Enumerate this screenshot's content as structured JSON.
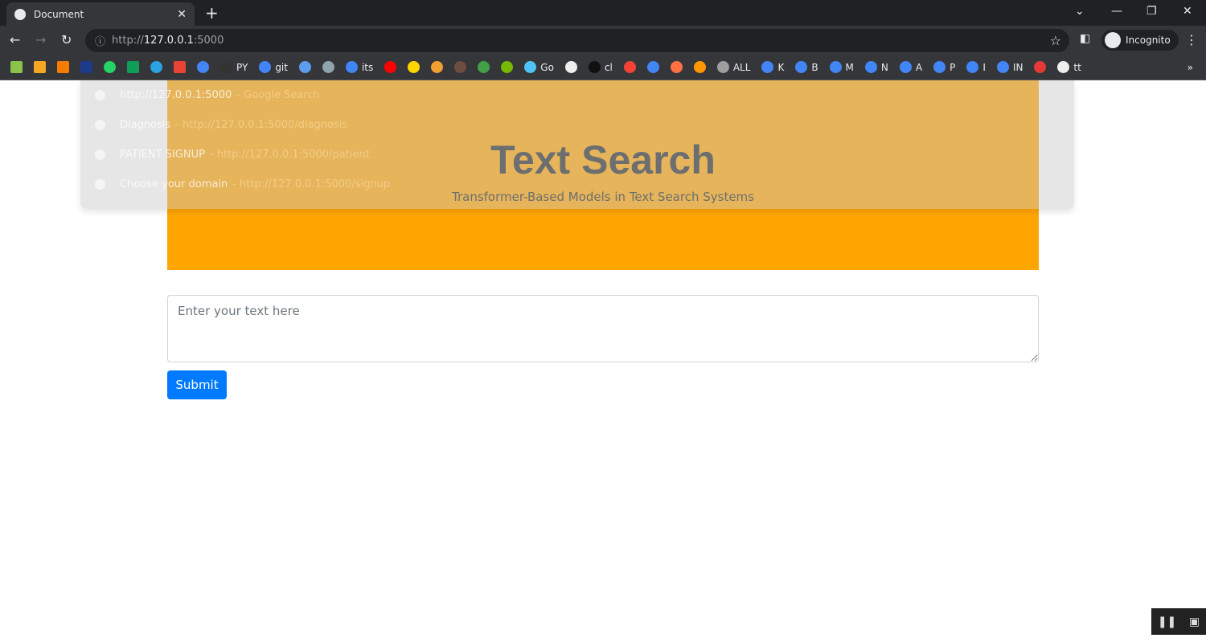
{
  "browser": {
    "tab_title": "Document",
    "url_scheme": "http://",
    "url_host": "127.0.0.1",
    "url_port": ":5000",
    "profile_label": "Incognito",
    "bookmarks": [
      {
        "label": "",
        "color": "#8bc34a"
      },
      {
        "label": "",
        "color": "#f5a623"
      },
      {
        "label": "",
        "color": "#f57c00"
      },
      {
        "label": "",
        "color": "#1e3a8a"
      },
      {
        "label": "",
        "color": "#25d366"
      },
      {
        "label": "",
        "color": "#0f9d58"
      },
      {
        "label": "",
        "color": "#2aa3e0"
      },
      {
        "label": "",
        "color": "#ea4335"
      },
      {
        "label": "",
        "color": "#4285f4"
      },
      {
        "label": "PY",
        "color": "#333333"
      },
      {
        "label": "git",
        "color": "#4285f4"
      },
      {
        "label": "",
        "color": "#5c9ded"
      },
      {
        "label": "",
        "color": "#90a4ae"
      },
      {
        "label": "its",
        "color": "#4285f4"
      },
      {
        "label": "",
        "color": "#ff0000"
      },
      {
        "label": "",
        "color": "#ffd600"
      },
      {
        "label": "",
        "color": "#f0a030"
      },
      {
        "label": "",
        "color": "#6d4c41"
      },
      {
        "label": "",
        "color": "#43a047"
      },
      {
        "label": "",
        "color": "#76b900"
      },
      {
        "label": "Go",
        "color": "#4fc3f7"
      },
      {
        "label": "",
        "color": "#eeeeee"
      },
      {
        "label": "cl",
        "color": "#111111"
      },
      {
        "label": "",
        "color": "#f44336"
      },
      {
        "label": "",
        "color": "#4285f4"
      },
      {
        "label": "",
        "color": "#ff7043"
      },
      {
        "label": "",
        "color": "#ff9800"
      },
      {
        "label": "ALL",
        "color": "#9e9e9e"
      },
      {
        "label": "K",
        "color": "#4285f4"
      },
      {
        "label": "B",
        "color": "#4285f4"
      },
      {
        "label": "M",
        "color": "#4285f4"
      },
      {
        "label": "N",
        "color": "#4285f4"
      },
      {
        "label": "A",
        "color": "#4285f4"
      },
      {
        "label": "P",
        "color": "#4285f4"
      },
      {
        "label": "I",
        "color": "#4285f4"
      },
      {
        "label": "IN",
        "color": "#4285f4"
      },
      {
        "label": "",
        "color": "#e53935"
      },
      {
        "label": "tt",
        "color": "#eeeeee"
      }
    ],
    "more_bookmarks": "»"
  },
  "omnibox_suggestions": [
    {
      "title": "http://127.0.0.1:5000",
      "url": "- Google Search",
      "icon": "search-icon"
    },
    {
      "title": "Diagnosis",
      "url": "- http://127.0.0.1:5000/diagnosis",
      "icon": "globe-icon"
    },
    {
      "title": "PATIENT SIGNUP",
      "url": "- http://127.0.0.1:5000/patient",
      "icon": "globe-icon"
    },
    {
      "title": "Choose your domain",
      "url": "- http://127.0.0.1:5000/signup",
      "icon": "globe-icon"
    }
  ],
  "page": {
    "title": "Text Search",
    "subtitle": "Transformer-Based Models in Text Search Systems",
    "input_placeholder": "Enter your text here",
    "submit_label": "Submit",
    "header_color": "#ffa500",
    "button_color": "#007bff"
  }
}
